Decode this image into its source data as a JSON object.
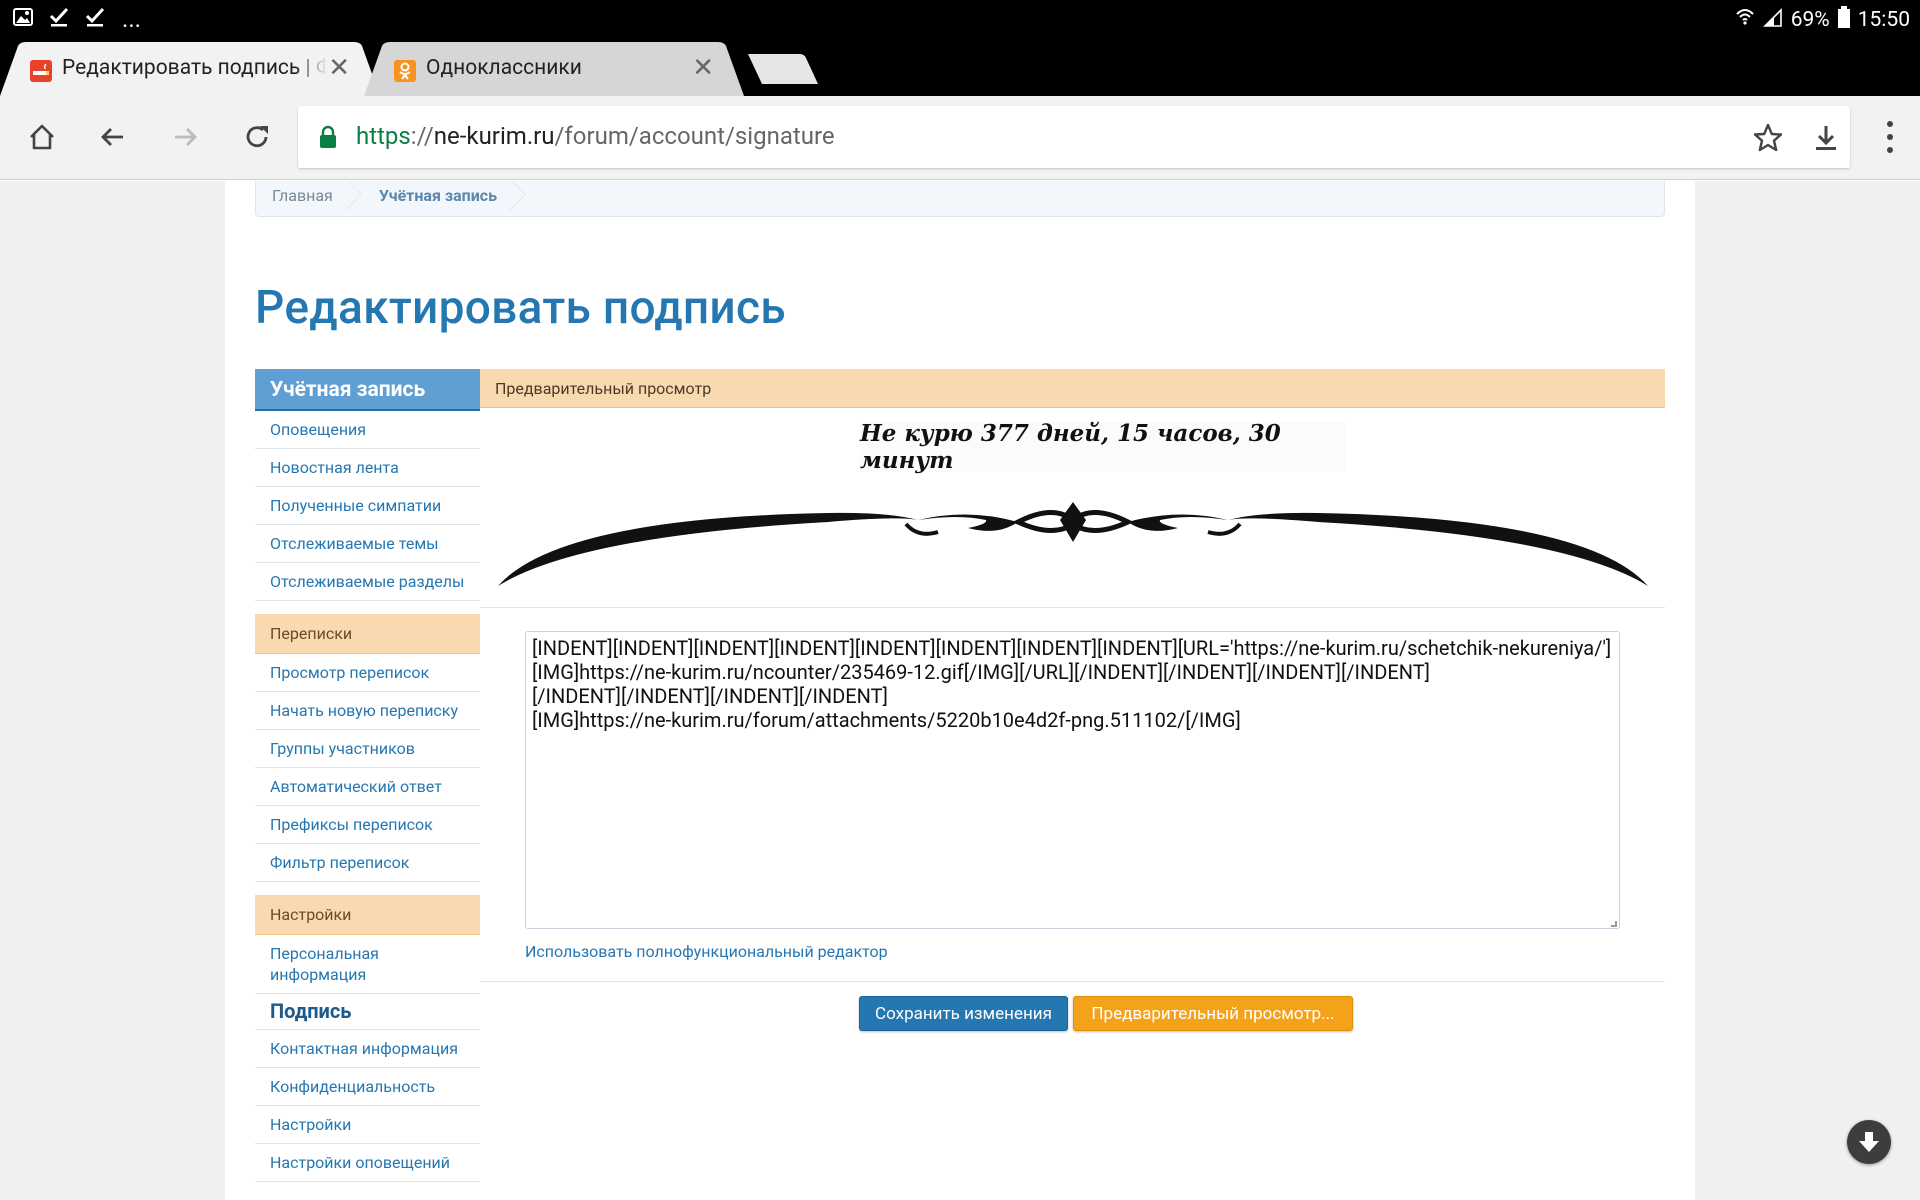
{
  "status_bar": {
    "more": "...",
    "battery": "69%",
    "time": "15:50"
  },
  "tabs": [
    {
      "title": "Редактировать подпись | Ф",
      "favicon": "smoking-site-favicon",
      "active": true
    },
    {
      "title": "Одноклассники",
      "favicon": "odnoklassniki-favicon",
      "active": false
    }
  ],
  "toolbar": {
    "url_scheme": "https",
    "url_sep": "://",
    "url_host": "ne-kurim.ru",
    "url_path": "/forum/account/signature"
  },
  "breadcrumb": [
    "Главная",
    "Учётная запись"
  ],
  "page_title": "Редактировать подпись",
  "sidebar": {
    "account_title": "Учётная запись",
    "account_items": [
      "Оповещения",
      "Новостная лента",
      "Полученные симпатии",
      "Отслеживаемые темы",
      "Отслеживаемые разделы"
    ],
    "conversations_title": "Переписки",
    "conversations_items": [
      "Просмотр переписок",
      "Начать новую переписку",
      "Группы участников",
      "Автоматический ответ",
      "Префиксы переписок",
      "Фильтр переписок"
    ],
    "settings_title": "Настройки",
    "settings_items": [
      "Персональная информация",
      "Подпись",
      "Контактная информация",
      "Конфиденциальность",
      "Настройки",
      "Настройки оповещений"
    ]
  },
  "main": {
    "preview_title": "Предварительный просмотр",
    "signature_banner": "Не курю 377 дней, 15 часов, 30 минут",
    "editor_value": "[INDENT][INDENT][INDENT][INDENT][INDENT][INDENT][INDENT][INDENT][URL='https://ne-kurim.ru/schetchik-nekureniya/'][IMG]https://ne-kurim.ru/ncounter/235469-12.gif[/IMG][/URL][/INDENT][/INDENT][/INDENT][/INDENT]\n[/INDENT][/INDENT][/INDENT][/INDENT]\n[IMG]https://ne-kurim.ru/forum/attachments/5220b10e4d2f-png.511102/[/IMG]",
    "full_editor_link": "Использовать полнофункциональный редактор",
    "save_button": "Сохранить изменения",
    "preview_button": "Предварительный просмотр..."
  },
  "colors": {
    "accent": "#2577b1",
    "section_header": "#f9d9b0",
    "save_button": "#2577b1",
    "preview_button": "#f5a21b"
  }
}
